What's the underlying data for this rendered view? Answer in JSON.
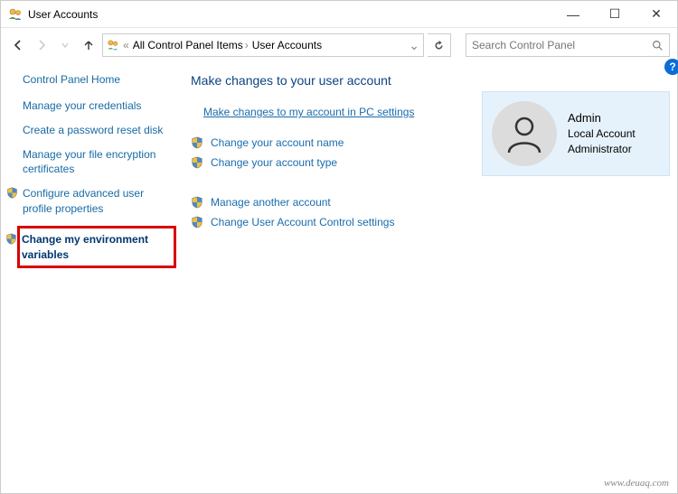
{
  "window": {
    "title": "User Accounts",
    "minimize": "—",
    "maximize": "☐",
    "close": "✕"
  },
  "nav": {
    "breadcrumb1": "All Control Panel Items",
    "breadcrumb2": "User Accounts",
    "sep_icon": "«",
    "arrow": "›",
    "dropdown": "⌄",
    "refresh": "↻"
  },
  "search": {
    "placeholder": "Search Control Panel",
    "icon": "⌕"
  },
  "sidebar": {
    "home": "Control Panel Home",
    "items": [
      {
        "label": "Manage your credentials",
        "shield": false
      },
      {
        "label": "Create a password reset disk",
        "shield": false
      },
      {
        "label": "Manage your file encryption certificates",
        "shield": false
      },
      {
        "label": "Configure advanced user profile properties",
        "shield": true
      },
      {
        "label": "Change my environment variables",
        "shield": true,
        "highlight": true
      }
    ]
  },
  "main": {
    "heading": "Make changes to your user account",
    "top_link": "Make changes to my account in PC settings",
    "links1": [
      "Change your account name",
      "Change your account type"
    ],
    "links2": [
      "Manage another account",
      "Change User Account Control settings"
    ]
  },
  "user": {
    "name": "Admin",
    "line2": "Local Account",
    "line3": "Administrator"
  },
  "help_icon": "?",
  "watermark": "www.deuaq.com"
}
